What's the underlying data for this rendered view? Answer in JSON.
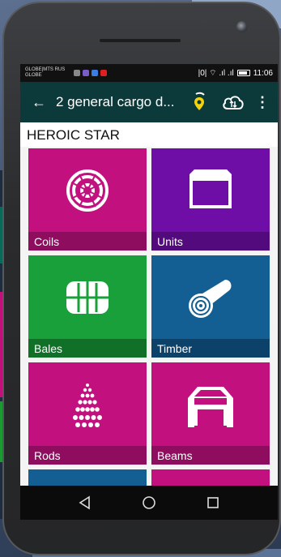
{
  "status_bar": {
    "carrier_line1": "GLOBE|MTS RUS",
    "carrier_line2": "GLOBE",
    "time": "11:06",
    "signal_text": "|0| ⌔ .ıl .ıl"
  },
  "app_bar": {
    "back_icon": "back-arrow-icon",
    "title": "2 general cargo d...",
    "pin_icon": "location-pin-icon",
    "cloud_icon": "cloud-sync-icon",
    "more_icon": "more-vert-icon"
  },
  "ship_name": "HEROIC STAR",
  "cargo_tiles": [
    {
      "label": "Coils",
      "icon": "coil-icon",
      "color": "#c2117e",
      "bar": "#8f0d5f"
    },
    {
      "label": "Units",
      "icon": "unit-icon",
      "color": "#6f0ea6",
      "bar": "#520a7c"
    },
    {
      "label": "Bales",
      "icon": "bale-icon",
      "color": "#1aa03a",
      "bar": "#117028"
    },
    {
      "label": "Timber",
      "icon": "timber-icon",
      "color": "#135e92",
      "bar": "#0c416a"
    },
    {
      "label": "Rods",
      "icon": "rods-icon",
      "color": "#c2117e",
      "bar": "#8f0d5f"
    },
    {
      "label": "Beams",
      "icon": "beams-icon",
      "color": "#c2117e",
      "bar": "#8f0d5f"
    }
  ],
  "partial_tiles": [
    {
      "color": "#135e92"
    },
    {
      "color": "#c2117e"
    }
  ],
  "nav": {
    "back": "nav-back-icon",
    "home": "nav-home-icon",
    "recents": "nav-recents-icon"
  }
}
